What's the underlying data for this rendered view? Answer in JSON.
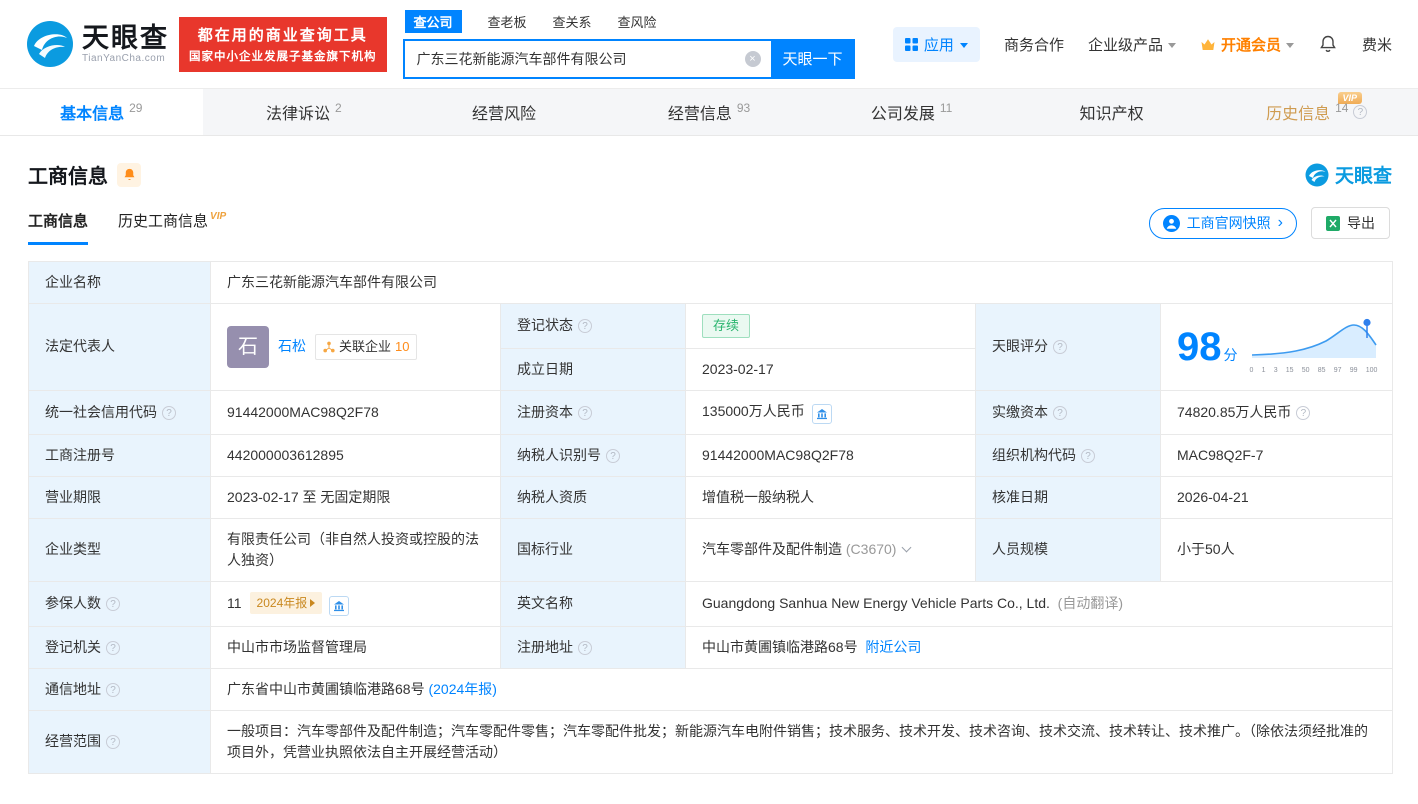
{
  "icons": {
    "help": "?",
    "clear": "×",
    "arrow_right": "›",
    "vip": "VIP"
  },
  "header": {
    "logo": {
      "title": "天眼查",
      "subtitle": "TianYanCha.com"
    },
    "slogan": {
      "line1": "都在用的商业查询工具",
      "line2": "国家中小企业发展子基金旗下机构"
    },
    "search": {
      "tabs": [
        {
          "label": "查公司"
        },
        {
          "label": "查老板"
        },
        {
          "label": "查关系"
        },
        {
          "label": "查风险"
        }
      ],
      "value": "广东三花新能源汽车部件有限公司",
      "button": "天眼一下"
    },
    "nav": {
      "apps": "应用",
      "cooperation": "商务合作",
      "enterprise": "企业级产品",
      "vip": "开通会员",
      "user": "费米"
    }
  },
  "tabs": [
    {
      "label": "基本信息",
      "count": "29"
    },
    {
      "label": "法律诉讼",
      "count": "2"
    },
    {
      "label": "经营风险",
      "count": ""
    },
    {
      "label": "经营信息",
      "count": "93"
    },
    {
      "label": "公司发展",
      "count": "11"
    },
    {
      "label": "知识产权",
      "count": ""
    },
    {
      "label": "历史信息",
      "count": "14"
    }
  ],
  "section": {
    "title": "工商信息",
    "brand": "天眼查",
    "subtab_current": "工商信息",
    "subtab_history": "历史工商信息",
    "snapshot_button": "工商官网快照",
    "export_button": "导出"
  },
  "info": {
    "company_name": {
      "label": "企业名称",
      "value": "广东三花新能源汽车部件有限公司"
    },
    "legal_rep": {
      "label": "法定代表人",
      "avatar": "石",
      "name": "石松",
      "related": "关联企业",
      "related_count": "10"
    },
    "reg_status": {
      "label": "登记状态",
      "value": "存续"
    },
    "establish_date": {
      "label": "成立日期",
      "value": "2023-02-17"
    },
    "score": {
      "label": "天眼评分",
      "value": "98",
      "unit": "分",
      "ticks": [
        "0",
        "1",
        "3",
        "15",
        "50",
        "85",
        "97",
        "99",
        "100"
      ]
    },
    "credit_code": {
      "label": "统一社会信用代码",
      "value": "91442000MAC98Q2F78"
    },
    "reg_capital": {
      "label": "注册资本",
      "value": "135000万人民币"
    },
    "paid_capital": {
      "label": "实缴资本",
      "value": "74820.85万人民币"
    },
    "reg_number": {
      "label": "工商注册号",
      "value": "442000003612895"
    },
    "taxpayer_id": {
      "label": "纳税人识别号",
      "value": "91442000MAC98Q2F78"
    },
    "org_code": {
      "label": "组织机构代码",
      "value": "MAC98Q2F-7"
    },
    "business_term": {
      "label": "营业期限",
      "value": "2023-02-17 至 无固定期限"
    },
    "taxpayer_quality": {
      "label": "纳税人资质",
      "value": "增值税一般纳税人"
    },
    "approval_date": {
      "label": "核准日期",
      "value": "2026-04-21"
    },
    "company_type": {
      "label": "企业类型",
      "value": "有限责任公司（非自然人投资或控股的法人独资）"
    },
    "industry": {
      "label": "国标行业",
      "value": "汽车零部件及配件制造",
      "code": "(C3670)"
    },
    "staff_size": {
      "label": "人员规模",
      "value": "小于50人"
    },
    "insured_count": {
      "label": "参保人数",
      "value": "11",
      "report_tag": "2024年报"
    },
    "english_name": {
      "label": "英文名称",
      "value": "Guangdong Sanhua New Energy Vehicle Parts Co., Ltd.",
      "note": "(自动翻译)"
    },
    "reg_authority": {
      "label": "登记机关",
      "value": "中山市市场监督管理局"
    },
    "reg_address": {
      "label": "注册地址",
      "value": "中山市黄圃镇临港路68号",
      "nearby": "附近公司"
    },
    "mail_address": {
      "label": "通信地址",
      "value": "广东省中山市黄圃镇临港路68号",
      "report_link": "(2024年报)"
    },
    "business_scope": {
      "label": "经营范围",
      "value": "一般项目：汽车零部件及配件制造；汽车零配件零售；汽车零配件批发；新能源汽车电附件销售；技术服务、技术开发、技术咨询、技术交流、技术转让、技术推广。（除依法须经批准的项目外，凭营业执照依法自主开展经营活动）"
    }
  }
}
